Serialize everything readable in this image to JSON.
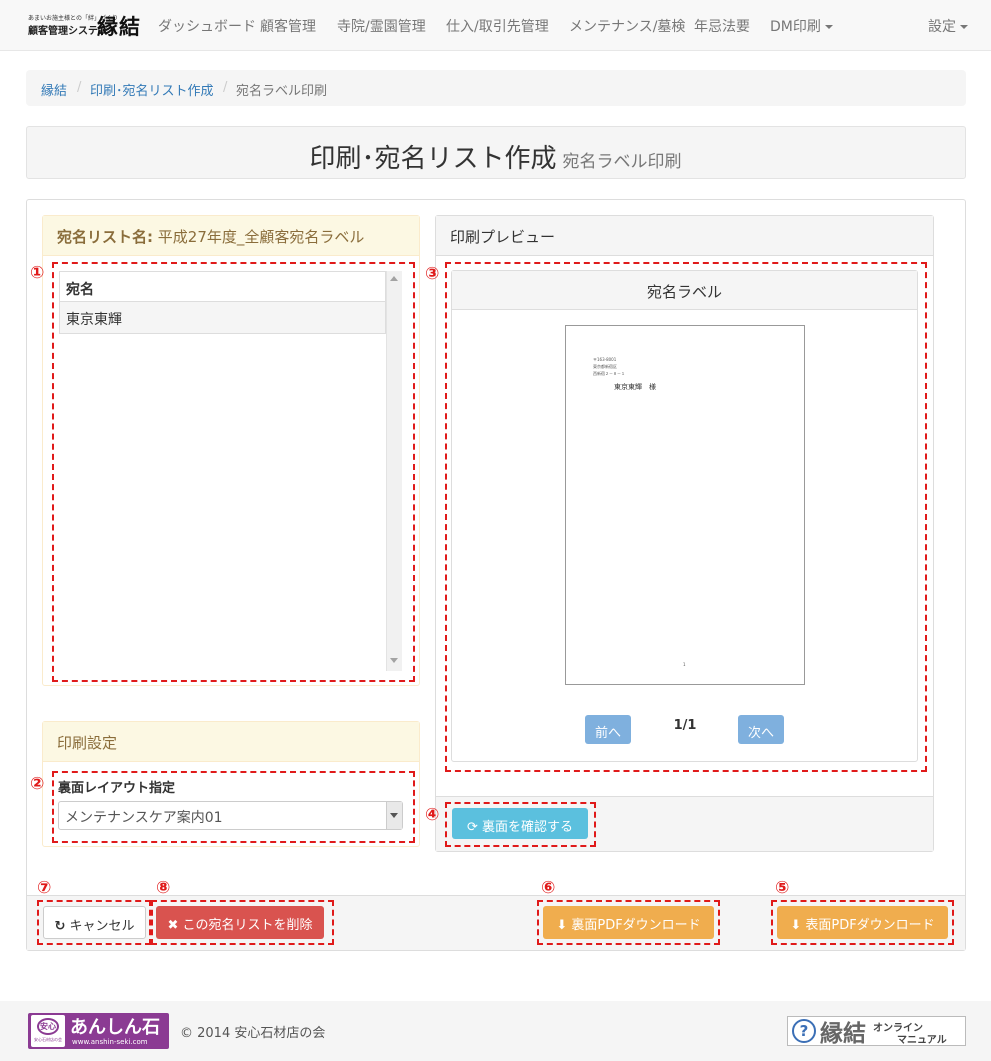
{
  "brand": {
    "line1": "あまいお施主様との「絆」づくり",
    "line2": "顧客管理システム",
    "name": "縁結"
  },
  "nav": {
    "items": [
      "ダッシュボード",
      "顧客管理",
      "寺院/霊園管理",
      "仕入/取引先管理",
      "メンテナンス/墓検",
      "年忌法要",
      "DM印刷"
    ],
    "settings": "設定"
  },
  "breadcrumb": {
    "home": "縁結",
    "parent": "印刷･宛名リスト作成",
    "current": "宛名ラベル印刷",
    "sep": "/"
  },
  "page": {
    "title": "印刷･宛名リスト作成",
    "subtitle": "宛名ラベル印刷"
  },
  "list_panel": {
    "heading_label": "宛名リスト名:",
    "heading_value": "平成27年度_全顧客宛名ラベル",
    "column": "宛名",
    "rows": [
      "東京東輝"
    ]
  },
  "print_settings": {
    "heading": "印刷設定",
    "layout_label": "裏面レイアウト指定",
    "layout_value": "メンテナンスケア案内01"
  },
  "preview": {
    "heading": "印刷プレビュー",
    "inner_heading": "宛名ラベル",
    "postal": "〒163-8001",
    "addr1": "東京都新宿区",
    "addr2": "西新宿２－８－１",
    "recipient": "東京東輝　様",
    "page_mark": "1",
    "prev": "前へ",
    "page_counter": "1/1",
    "next": "次へ",
    "check_back": "裏面を確認する"
  },
  "actions": {
    "cancel": "キャンセル",
    "delete": "この宛名リストを削除",
    "back_pdf": "裏面PDFダウンロード",
    "front_pdf": "表面PDFダウンロード"
  },
  "annotations": [
    "①",
    "②",
    "③",
    "④",
    "⑤",
    "⑥",
    "⑦",
    "⑧"
  ],
  "footer": {
    "logo_badge": "安心",
    "logo_badge_sub": "安心石材店の会",
    "logo_text": "あんしん石",
    "logo_url": "www.anshin-seki.com",
    "copyright": "© 2014 安心石材店の会",
    "manual_icon": "?",
    "manual_brand": "縁結",
    "manual_line1": "オンライン",
    "manual_line2": "マニュアル"
  },
  "colors": {
    "annotation": "#e01a1a",
    "warning": "#f0ad4e",
    "danger": "#d9534f",
    "info": "#5bc0de",
    "link": "#337ab7"
  }
}
